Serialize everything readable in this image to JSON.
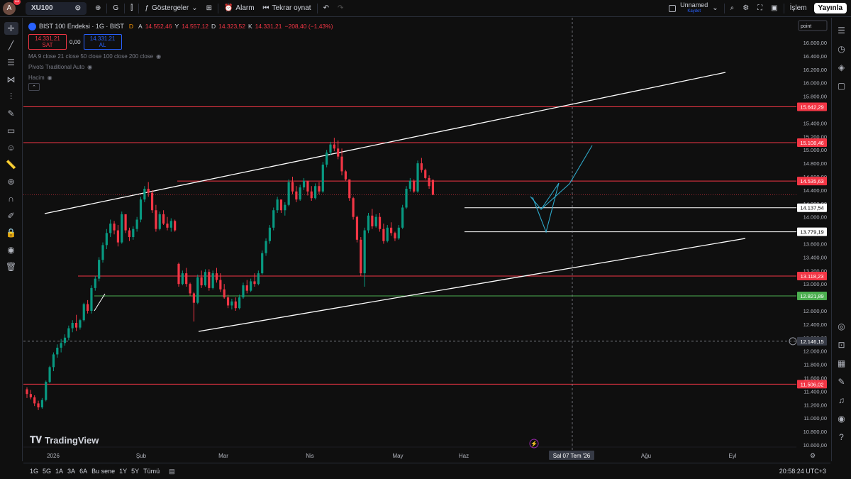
{
  "topbar": {
    "avatar_letter": "A",
    "notification_count": "11",
    "symbol": "XU100",
    "interval": "G",
    "indicators_label": "Göstergeler",
    "alarm_label": "Alarm",
    "replay_label": "Tekrar oynat",
    "layout_name": "Unnamed",
    "layout_status": "Kaydet",
    "trade_label": "İşlem",
    "publish_label": "Yayınla"
  },
  "legend": {
    "title": "BIST 100 Endeksi · 1G · BIST",
    "flag": "D",
    "o_label": "A",
    "o_value": "14.552,46",
    "h_label": "Y",
    "h_value": "14.557,12",
    "l_label": "D",
    "l_value": "14.323,52",
    "c_label": "K",
    "c_value": "14.331,21",
    "change": "−208,40 (−1,43%)",
    "sell_price": "14.331,21",
    "sell_label": "SAT",
    "spread": "0,00",
    "buy_price": "14.331,21",
    "buy_label": "AL",
    "indicators": [
      "MA 9 close 21 close 50 close 100 close 200 close",
      "Pivots Traditional Auto",
      "Hacim"
    ]
  },
  "price_axis": {
    "mode": "point",
    "ticks": [
      "16.600,00",
      "16.400,00",
      "16.200,00",
      "16.000,00",
      "15.800,00",
      "15.400,00",
      "15.200,00",
      "15.000,00",
      "14.800,00",
      "14.600,00",
      "14.400,00",
      "14.200,00",
      "14.000,00",
      "13.800,00",
      "13.600,00",
      "13.400,00",
      "13.200,00",
      "13.000,00",
      "12.800,00",
      "12.600,00",
      "12.400,00",
      "12.200,00",
      "12.000,00",
      "11.800,00",
      "11.600,00",
      "11.400,00",
      "11.200,00",
      "11.000,00",
      "10.800,00",
      "10.600,00"
    ],
    "tick_values": [
      16600,
      16400,
      16200,
      16000,
      15800,
      15400,
      15200,
      15000,
      14800,
      14600,
      14400,
      14200,
      14000,
      13800,
      13600,
      13400,
      13200,
      13000,
      12800,
      12600,
      12400,
      12200,
      12000,
      11800,
      11600,
      11400,
      11200,
      11000,
      10800,
      10600
    ],
    "crosshair_label": "12.146,15",
    "crosshair_value": 12146.15
  },
  "time_axis": {
    "labels": [
      "2026",
      "Şub",
      "Mar",
      "Nis",
      "May",
      "Haz",
      "Ağu",
      "Eyl"
    ],
    "crosshair_label": "Sal 07 Tem '26"
  },
  "chart_data": {
    "type": "candlestick",
    "symbol": "XU100",
    "horizontal_levels": [
      {
        "value": 15642.29,
        "label": "15.642,29",
        "color": "#f23645"
      },
      {
        "value": 15108.46,
        "label": "15.108,46",
        "color": "#f23645"
      },
      {
        "value": 14535.63,
        "label": "14.535,63",
        "color": "#f23645"
      },
      {
        "value": 14137.54,
        "label": "14.137,54",
        "color": "#ffffff"
      },
      {
        "value": 13779.19,
        "label": "13.779,19",
        "color": "#ffffff"
      },
      {
        "value": 13118.23,
        "label": "13.118,23",
        "color": "#f23645"
      },
      {
        "value": 12821.89,
        "label": "12.821,89",
        "color": "#4caf50"
      },
      {
        "value": 11506.02,
        "label": "11.506,02",
        "color": "#f23645"
      }
    ],
    "last_price": 14331.21,
    "candles": [
      [
        11430,
        11460,
        11300,
        11360
      ],
      [
        11360,
        11420,
        11280,
        11310
      ],
      [
        11310,
        11340,
        11180,
        11220
      ],
      [
        11220,
        11260,
        11120,
        11160
      ],
      [
        11160,
        11300,
        11140,
        11270
      ],
      [
        11270,
        11560,
        11250,
        11540
      ],
      [
        11540,
        11780,
        11520,
        11760
      ],
      [
        11760,
        11980,
        11700,
        11950
      ],
      [
        11950,
        12100,
        11900,
        12050
      ],
      [
        12050,
        12180,
        11980,
        12120
      ],
      [
        12120,
        12250,
        12080,
        12200
      ],
      [
        12200,
        12380,
        12160,
        12340
      ],
      [
        12340,
        12460,
        12280,
        12420
      ],
      [
        12420,
        12540,
        12300,
        12350
      ],
      [
        12350,
        12480,
        12320,
        12460
      ],
      [
        12460,
        12720,
        12440,
        12700
      ],
      [
        12700,
        12760,
        12560,
        12600
      ],
      [
        12600,
        12980,
        12560,
        12940
      ],
      [
        12940,
        13120,
        12900,
        13080
      ],
      [
        13080,
        13400,
        13040,
        13360
      ],
      [
        13360,
        13620,
        13320,
        13580
      ],
      [
        13580,
        13820,
        13520,
        13760
      ],
      [
        13760,
        13960,
        13700,
        13900
      ],
      [
        13900,
        13940,
        13740,
        13800
      ],
      [
        13800,
        13880,
        13560,
        13620
      ],
      [
        13620,
        14080,
        13600,
        14040
      ],
      [
        14040,
        13980,
        13760,
        13800
      ],
      [
        13800,
        13840,
        13640,
        13700
      ],
      [
        13700,
        13860,
        13660,
        13820
      ],
      [
        13820,
        14000,
        13780,
        13960
      ],
      [
        13960,
        14300,
        13920,
        14260
      ],
      [
        14260,
        14460,
        14220,
        14420
      ],
      [
        14420,
        14520,
        14300,
        14360
      ],
      [
        14360,
        14400,
        14060,
        14100
      ],
      [
        14100,
        14180,
        13780,
        13820
      ],
      [
        13820,
        14080,
        13800,
        14040
      ],
      [
        14040,
        14100,
        13880,
        13900
      ],
      [
        13900,
        14000,
        13800,
        13840
      ],
      [
        13840,
        13980,
        13780,
        13940
      ],
      [
        13940,
        13960,
        13780,
        13800
      ],
      [
        13300,
        13320,
        12960,
        13000
      ],
      [
        13000,
        13200,
        12980,
        13160
      ],
      [
        13160,
        13240,
        12960,
        13000
      ],
      [
        13000,
        13020,
        12820,
        12860
      ],
      [
        12860,
        12880,
        12440,
        12720
      ],
      [
        12720,
        13140,
        12700,
        13100
      ],
      [
        13100,
        13200,
        12940,
        12980
      ],
      [
        12980,
        13220,
        12960,
        13180
      ],
      [
        13180,
        13220,
        12900,
        12940
      ],
      [
        12940,
        13200,
        12920,
        13160
      ],
      [
        13160,
        13240,
        13020,
        13060
      ],
      [
        13060,
        13160,
        12880,
        12920
      ],
      [
        12920,
        13000,
        12780,
        12800
      ],
      [
        12800,
        12840,
        12640,
        12680
      ],
      [
        12680,
        12780,
        12620,
        12740
      ],
      [
        12740,
        12800,
        12600,
        12640
      ],
      [
        12640,
        12840,
        12620,
        12800
      ],
      [
        12800,
        13020,
        12780,
        12980
      ],
      [
        12980,
        13060,
        12860,
        12900
      ],
      [
        12900,
        13080,
        12880,
        13040
      ],
      [
        13040,
        13160,
        12960,
        13000
      ],
      [
        13000,
        13200,
        12980,
        13160
      ],
      [
        13160,
        13500,
        13140,
        13460
      ],
      [
        13460,
        13680,
        13420,
        13640
      ],
      [
        13640,
        13880,
        13600,
        13840
      ],
      [
        13840,
        14140,
        13800,
        14100
      ],
      [
        14100,
        14300,
        14060,
        14260
      ],
      [
        14260,
        14180,
        14060,
        14100
      ],
      [
        14100,
        14220,
        14020,
        14180
      ],
      [
        14180,
        14560,
        14160,
        14520
      ],
      [
        14520,
        14600,
        14340,
        14380
      ],
      [
        14380,
        14460,
        14220,
        14260
      ],
      [
        14260,
        14480,
        14240,
        14440
      ],
      [
        14440,
        14580,
        14400,
        14540
      ],
      [
        14540,
        14500,
        14320,
        14380
      ],
      [
        14380,
        14460,
        14240,
        14280
      ],
      [
        14280,
        14500,
        14260,
        14460
      ],
      [
        14460,
        14520,
        14340,
        14380
      ],
      [
        14380,
        14820,
        14360,
        14780
      ],
      [
        14780,
        15000,
        14740,
        14960
      ],
      [
        14960,
        15120,
        14920,
        15080
      ],
      [
        15080,
        15180,
        14980,
        15020
      ],
      [
        15020,
        15140,
        14860,
        14900
      ],
      [
        14900,
        15020,
        14620,
        14680
      ],
      [
        14680,
        14700,
        14540,
        14560
      ],
      [
        14560,
        14540,
        14240,
        14280
      ],
      [
        14280,
        14300,
        13960,
        14000
      ],
      [
        14000,
        14020,
        13620,
        13660
      ],
      [
        13660,
        13700,
        13120,
        13160
      ],
      [
        13160,
        13840,
        12960,
        13800
      ],
      [
        13800,
        14060,
        13760,
        14020
      ],
      [
        14020,
        14120,
        13820,
        13860
      ],
      [
        13860,
        14040,
        13840,
        14000
      ],
      [
        14000,
        14060,
        13780,
        13820
      ],
      [
        13820,
        13900,
        13600,
        13640
      ],
      [
        13640,
        13880,
        13620,
        13840
      ],
      [
        13840,
        13920,
        13720,
        13760
      ],
      [
        13760,
        13780,
        13640,
        13680
      ],
      [
        13680,
        13880,
        13660,
        13840
      ],
      [
        13840,
        14180,
        13820,
        14140
      ],
      [
        14140,
        14460,
        14120,
        14420
      ],
      [
        14420,
        14580,
        14380,
        14540
      ],
      [
        14540,
        14560,
        14360,
        14380
      ],
      [
        14380,
        14840,
        14360,
        14800
      ],
      [
        14800,
        14880,
        14660,
        14700
      ],
      [
        14700,
        14720,
        14560,
        14580
      ],
      [
        14580,
        14620,
        14420,
        14460
      ],
      [
        14552.46,
        14557.12,
        14323.52,
        14331.21
      ]
    ]
  },
  "bottombar": {
    "ranges": [
      "1G",
      "5G",
      "1A",
      "3A",
      "6A",
      "Bu sene",
      "1Y",
      "5Y",
      "Tümü"
    ],
    "clock": "20:58:24 UTC+3"
  },
  "branding": {
    "name": "TradingView"
  },
  "colors": {
    "up": "#089981",
    "down": "#f23645",
    "level_red": "#f23645",
    "level_green": "#4caf50",
    "projection": "#2fa8c9"
  }
}
